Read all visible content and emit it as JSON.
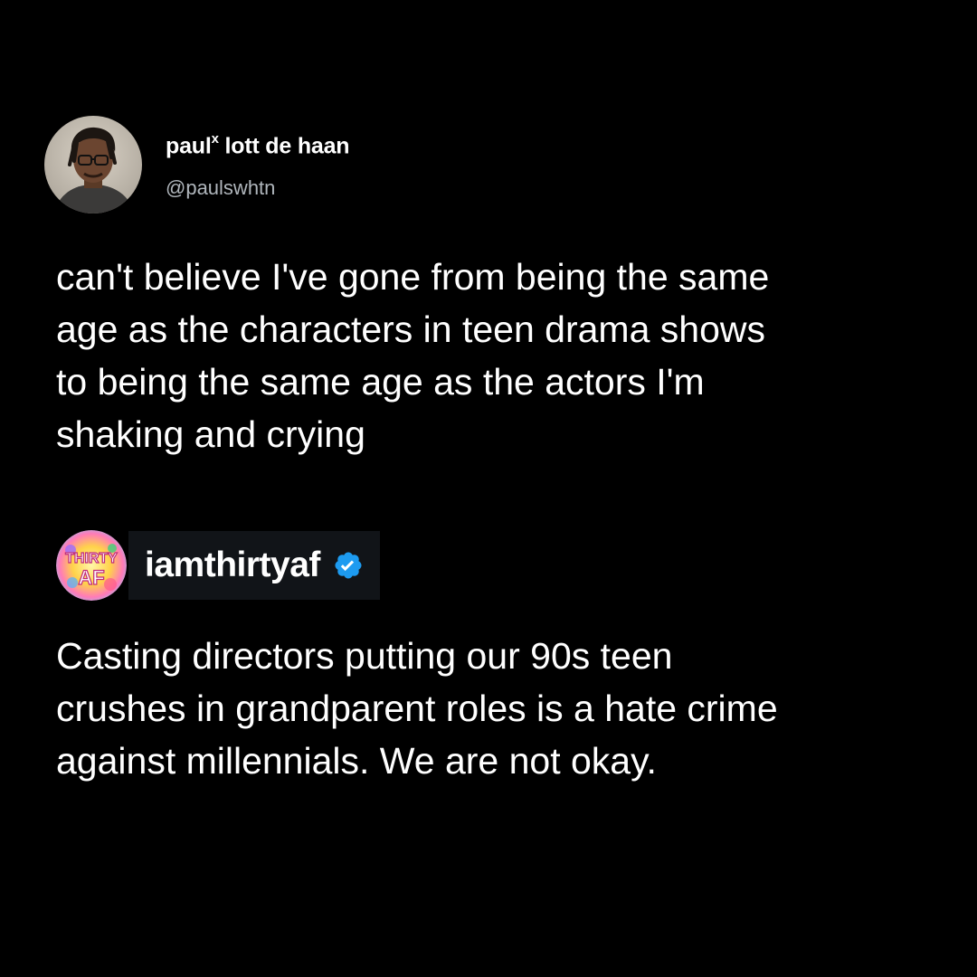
{
  "tweet": {
    "author_name": "paul",
    "author_name_superscript": "x",
    "author_name_rest": " lott de haan",
    "author_handle": "@paulswhtn",
    "text_lines": [
      "can't believe I've gone from being the same",
      "age as the characters in teen drama shows",
      "to being the same age as the actors I'm",
      "shaking and crying"
    ]
  },
  "post": {
    "avatar_logo_text_top": "THIRTY",
    "avatar_logo_text_bottom": "AF",
    "account_name": "iamthirtyaf",
    "verified_icon": "verified-badge-icon",
    "text_lines": [
      "Casting directors putting our 90s teen",
      "crushes in grandparent roles is a hate crime",
      "against millennials. We are not okay."
    ]
  },
  "colors": {
    "background": "#000000",
    "text": "#ffffff",
    "handle": "#b0b6bc",
    "account_tag_bg": "#111418",
    "verified_blue": "#1d9bf0"
  }
}
